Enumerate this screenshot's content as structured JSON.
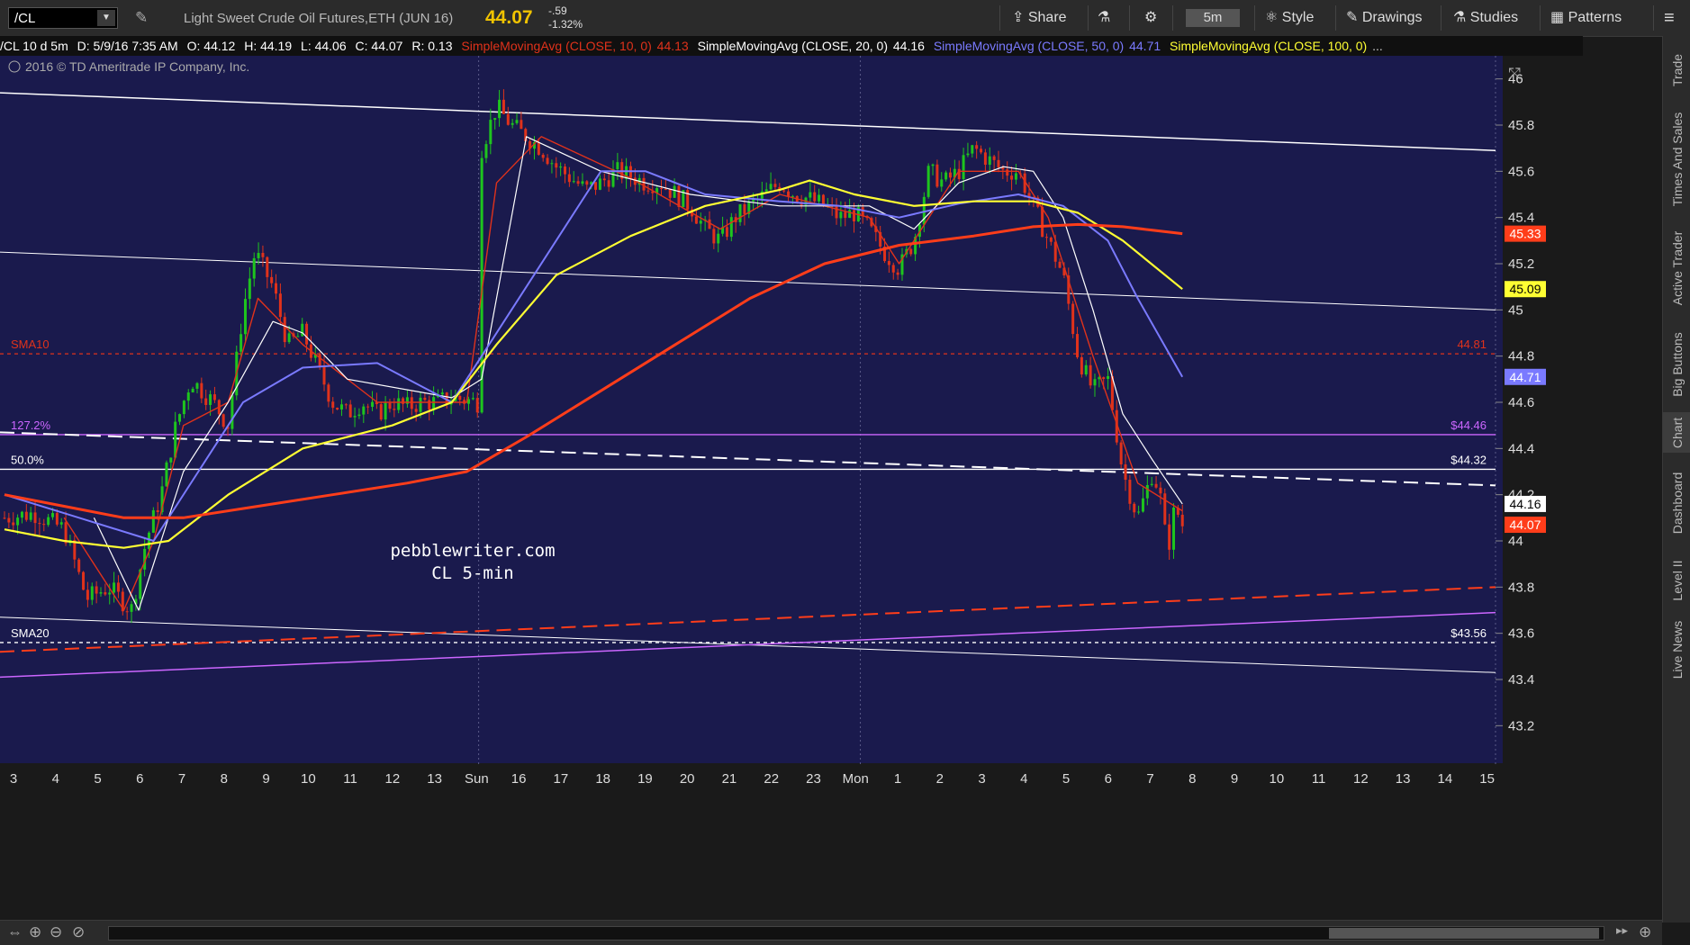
{
  "toolbar": {
    "symbol": "/CL",
    "description": "Light Sweet Crude Oil Futures,ETH (JUN 16)",
    "last": "44.07",
    "change": "-.59",
    "change_pct": "-1.32%",
    "share": "Share",
    "period": "5m",
    "style": "Style",
    "drawings": "Drawings",
    "studies": "Studies",
    "patterns": "Patterns"
  },
  "status": {
    "info": "/CL 10 d 5m",
    "date": "D: 5/9/16 7:35 AM",
    "open": "O: 44.12",
    "high": "H: 44.19",
    "low": "L: 44.06",
    "close": "C: 44.07",
    "range": "R: 0.13",
    "sma10": "SimpleMovingAvg (CLOSE, 10, 0)",
    "sma10_val": "44.13",
    "sma20": "SimpleMovingAvg (CLOSE, 20, 0)",
    "sma20_val": "44.16",
    "sma50": "SimpleMovingAvg (CLOSE, 50, 0)",
    "sma50_val": "44.71",
    "sma100": "SimpleMovingAvg (CLOSE, 100, 0)",
    "ellipsis": "..."
  },
  "copyright": "2016 © TD Ameritrade IP Company, Inc.",
  "watermark": [
    "pebblewriter.com",
    "CL 5-min"
  ],
  "sidebar": [
    "Trade",
    "Times And Sales",
    "Active Trader",
    "Big Buttons",
    "Chart",
    "Dashboard",
    "Level II",
    "Live News"
  ],
  "colors": {
    "background": "#1a1a4d",
    "sma10": "#e0321b",
    "sma20": "#ffffff",
    "sma50": "#7a7aff",
    "sma100": "#ffff33",
    "sma200": "#ff3d1a",
    "fib": "#cc66ff",
    "up": "#1ec41e",
    "down": "#e0321b",
    "last_price": "#ffcc00"
  },
  "chart_data": {
    "type": "candlestick",
    "ylim": [
      43.1,
      46.1
    ],
    "yticks": [
      46,
      45.8,
      45.6,
      45.4,
      45.2,
      45,
      44.8,
      44.6,
      44.4,
      44.2,
      44,
      43.8,
      43.6,
      43.4,
      43.2
    ],
    "xticks": [
      "3",
      "4",
      "5",
      "6",
      "7",
      "8",
      "9",
      "10",
      "11",
      "12",
      "13",
      "Sun",
      "16",
      "17",
      "18",
      "19",
      "20",
      "21",
      "22",
      "23",
      "Mon",
      "1",
      "2",
      "3",
      "4",
      "5",
      "6",
      "7",
      "8",
      "9",
      "10",
      "11",
      "12",
      "13",
      "14",
      "15"
    ],
    "price_labels": [
      {
        "label": "45.33",
        "value": 45.33,
        "color": "#ff3d1a"
      },
      {
        "label": "45.09",
        "value": 45.09,
        "color": "#ffff33"
      },
      {
        "label": "44.71",
        "value": 44.71,
        "color": "#7a7aff"
      },
      {
        "label": "44.16",
        "value": 44.16,
        "color": "#ffffff"
      },
      {
        "label": "44.07",
        "value": 44.07,
        "color": "#ff3d1a"
      }
    ],
    "horizontal_lines": [
      {
        "name": "SMA10",
        "value": 44.81,
        "label": "44.81",
        "style": "dotted",
        "color": "#e0321b"
      },
      {
        "name": "127.2%",
        "value": 44.46,
        "label": "$44.46",
        "style": "solid",
        "color": "#cc66ff"
      },
      {
        "name": "50.0%",
        "value": 44.31,
        "label": "$44.32",
        "style": "solid",
        "color": "#ffffff"
      },
      {
        "name": "SMA20",
        "value": 43.56,
        "label": "$43.56",
        "style": "dotted",
        "color": "#ffffff"
      }
    ],
    "trend_lines": [
      {
        "from": [
          0.0,
          45.94
        ],
        "to": [
          1.0,
          45.69
        ],
        "style": "solid",
        "color": "#ffffff",
        "width": 1.5
      },
      {
        "from": [
          0.0,
          45.25
        ],
        "to": [
          1.0,
          45.0
        ],
        "style": "solid",
        "color": "#ffffff",
        "width": 1
      },
      {
        "from": [
          0.0,
          44.47
        ],
        "to": [
          1.0,
          44.24
        ],
        "style": "dashed",
        "color": "#ffffff",
        "width": 2
      },
      {
        "from": [
          0.0,
          43.67
        ],
        "to": [
          1.0,
          43.43
        ],
        "style": "solid",
        "color": "#ffffff",
        "width": 1
      },
      {
        "from": [
          0.0,
          43.52
        ],
        "to": [
          1.0,
          43.8
        ],
        "style": "dashed",
        "color": "#ff3d1a",
        "width": 2
      },
      {
        "from": [
          0.0,
          43.41
        ],
        "to": [
          1.0,
          43.69
        ],
        "style": "solid",
        "color": "#cc66ff",
        "width": 1.5
      }
    ],
    "close_path": [
      [
        0.0,
        44.1
      ],
      [
        0.02,
        44.12
      ],
      [
        0.04,
        44.05
      ],
      [
        0.055,
        43.75
      ],
      [
        0.07,
        43.8
      ],
      [
        0.085,
        43.7
      ],
      [
        0.095,
        44.0
      ],
      [
        0.105,
        44.2
      ],
      [
        0.115,
        44.5
      ],
      [
        0.125,
        44.7
      ],
      [
        0.14,
        44.6
      ],
      [
        0.15,
        44.5
      ],
      [
        0.16,
        45.0
      ],
      [
        0.168,
        45.25
      ],
      [
        0.18,
        45.1
      ],
      [
        0.19,
        44.85
      ],
      [
        0.2,
        44.9
      ],
      [
        0.21,
        44.75
      ],
      [
        0.22,
        44.6
      ],
      [
        0.23,
        44.55
      ],
      [
        0.24,
        44.6
      ],
      [
        0.25,
        44.55
      ],
      [
        0.26,
        44.6
      ],
      [
        0.27,
        44.58
      ],
      [
        0.28,
        44.6
      ],
      [
        0.29,
        44.6
      ],
      [
        0.3,
        44.62
      ],
      [
        0.318,
        44.6
      ],
      [
        0.32,
        45.7
      ],
      [
        0.33,
        45.88
      ],
      [
        0.34,
        45.8
      ],
      [
        0.35,
        45.75
      ],
      [
        0.36,
        45.7
      ],
      [
        0.37,
        45.62
      ],
      [
        0.38,
        45.57
      ],
      [
        0.39,
        45.52
      ],
      [
        0.4,
        45.55
      ],
      [
        0.41,
        45.6
      ],
      [
        0.42,
        45.58
      ],
      [
        0.43,
        45.55
      ],
      [
        0.44,
        45.55
      ],
      [
        0.45,
        45.5
      ],
      [
        0.46,
        45.45
      ],
      [
        0.47,
        45.35
      ],
      [
        0.48,
        45.3
      ],
      [
        0.49,
        45.4
      ],
      [
        0.5,
        45.45
      ],
      [
        0.51,
        45.5
      ],
      [
        0.52,
        45.55
      ],
      [
        0.53,
        45.5
      ],
      [
        0.54,
        45.48
      ],
      [
        0.55,
        45.45
      ],
      [
        0.56,
        45.4
      ],
      [
        0.57,
        45.42
      ],
      [
        0.58,
        45.35
      ],
      [
        0.59,
        45.25
      ],
      [
        0.6,
        45.18
      ],
      [
        0.61,
        45.3
      ],
      [
        0.62,
        45.6
      ],
      [
        0.63,
        45.55
      ],
      [
        0.64,
        45.6
      ],
      [
        0.65,
        45.7
      ],
      [
        0.66,
        45.65
      ],
      [
        0.67,
        45.6
      ],
      [
        0.68,
        45.6
      ],
      [
        0.69,
        45.45
      ],
      [
        0.7,
        45.3
      ],
      [
        0.71,
        45.15
      ],
      [
        0.72,
        44.8
      ],
      [
        0.73,
        44.65
      ],
      [
        0.74,
        44.7
      ],
      [
        0.75,
        44.3
      ],
      [
        0.755,
        44.2
      ],
      [
        0.76,
        44.1
      ],
      [
        0.77,
        44.3
      ],
      [
        0.775,
        44.2
      ],
      [
        0.78,
        43.95
      ],
      [
        0.785,
        44.15
      ],
      [
        0.79,
        44.07
      ]
    ],
    "sma_paths": {
      "sma10": [
        [
          0.04,
          44.1
        ],
        [
          0.08,
          43.7
        ],
        [
          0.1,
          44.0
        ],
        [
          0.12,
          44.5
        ],
        [
          0.15,
          44.6
        ],
        [
          0.17,
          45.05
        ],
        [
          0.2,
          44.85
        ],
        [
          0.25,
          44.6
        ],
        [
          0.31,
          44.6
        ],
        [
          0.33,
          45.55
        ],
        [
          0.36,
          45.75
        ],
        [
          0.42,
          45.57
        ],
        [
          0.48,
          45.35
        ],
        [
          0.52,
          45.5
        ],
        [
          0.58,
          45.4
        ],
        [
          0.6,
          45.2
        ],
        [
          0.64,
          45.6
        ],
        [
          0.68,
          45.6
        ],
        [
          0.7,
          45.4
        ],
        [
          0.73,
          44.8
        ],
        [
          0.76,
          44.25
        ],
        [
          0.79,
          44.13
        ]
      ],
      "sma20": [
        [
          0.06,
          44.1
        ],
        [
          0.09,
          43.7
        ],
        [
          0.12,
          44.3
        ],
        [
          0.15,
          44.6
        ],
        [
          0.18,
          44.95
        ],
        [
          0.2,
          44.9
        ],
        [
          0.23,
          44.7
        ],
        [
          0.3,
          44.62
        ],
        [
          0.32,
          44.7
        ],
        [
          0.35,
          45.75
        ],
        [
          0.4,
          45.6
        ],
        [
          0.46,
          45.5
        ],
        [
          0.52,
          45.45
        ],
        [
          0.58,
          45.45
        ],
        [
          0.61,
          45.35
        ],
        [
          0.64,
          45.55
        ],
        [
          0.67,
          45.62
        ],
        [
          0.69,
          45.6
        ],
        [
          0.71,
          45.4
        ],
        [
          0.73,
          45.0
        ],
        [
          0.75,
          44.55
        ],
        [
          0.77,
          44.35
        ],
        [
          0.79,
          44.16
        ]
      ],
      "sma50": [
        [
          0.0,
          44.2
        ],
        [
          0.05,
          44.1
        ],
        [
          0.1,
          44.0
        ],
        [
          0.13,
          44.3
        ],
        [
          0.16,
          44.6
        ],
        [
          0.2,
          44.75
        ],
        [
          0.25,
          44.77
        ],
        [
          0.3,
          44.6
        ],
        [
          0.35,
          45.1
        ],
        [
          0.4,
          45.6
        ],
        [
          0.43,
          45.6
        ],
        [
          0.47,
          45.5
        ],
        [
          0.52,
          45.47
        ],
        [
          0.56,
          45.45
        ],
        [
          0.6,
          45.4
        ],
        [
          0.64,
          45.46
        ],
        [
          0.68,
          45.5
        ],
        [
          0.71,
          45.45
        ],
        [
          0.74,
          45.3
        ],
        [
          0.76,
          45.05
        ],
        [
          0.79,
          44.71
        ]
      ],
      "sma100": [
        [
          0.0,
          44.05
        ],
        [
          0.04,
          44.0
        ],
        [
          0.08,
          43.97
        ],
        [
          0.11,
          44.0
        ],
        [
          0.15,
          44.2
        ],
        [
          0.2,
          44.4
        ],
        [
          0.26,
          44.5
        ],
        [
          0.3,
          44.6
        ],
        [
          0.33,
          44.85
        ],
        [
          0.37,
          45.15
        ],
        [
          0.42,
          45.32
        ],
        [
          0.47,
          45.45
        ],
        [
          0.52,
          45.52
        ],
        [
          0.54,
          45.56
        ],
        [
          0.57,
          45.5
        ],
        [
          0.61,
          45.45
        ],
        [
          0.65,
          45.47
        ],
        [
          0.69,
          45.47
        ],
        [
          0.72,
          45.42
        ],
        [
          0.75,
          45.3
        ],
        [
          0.79,
          45.09
        ]
      ],
      "sma200": [
        [
          0.0,
          44.2
        ],
        [
          0.04,
          44.15
        ],
        [
          0.08,
          44.1
        ],
        [
          0.12,
          44.1
        ],
        [
          0.17,
          44.15
        ],
        [
          0.22,
          44.2
        ],
        [
          0.27,
          44.25
        ],
        [
          0.31,
          44.3
        ],
        [
          0.35,
          44.45
        ],
        [
          0.4,
          44.65
        ],
        [
          0.45,
          44.85
        ],
        [
          0.5,
          45.05
        ],
        [
          0.55,
          45.2
        ],
        [
          0.6,
          45.28
        ],
        [
          0.65,
          45.32
        ],
        [
          0.69,
          45.36
        ],
        [
          0.72,
          45.37
        ],
        [
          0.75,
          45.36
        ],
        [
          0.79,
          45.33
        ]
      ]
    }
  }
}
